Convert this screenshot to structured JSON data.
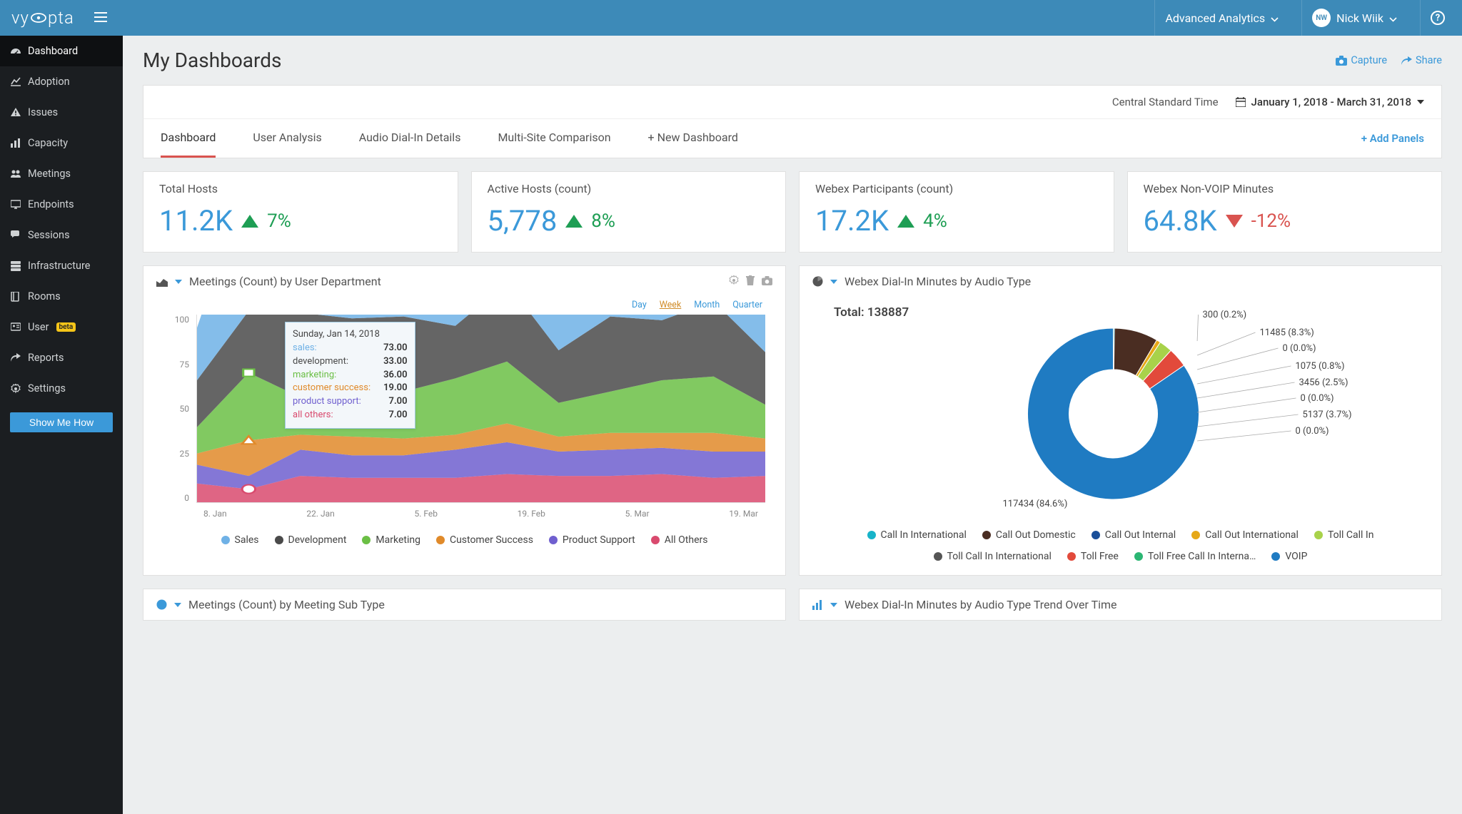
{
  "header": {
    "logo_text": "vy  pta",
    "product_dropdown": "Advanced Analytics",
    "user_initials": "NW",
    "user_name": "Nick Wiik"
  },
  "sidebar": {
    "items": [
      {
        "label": "Dashboard",
        "icon": "gauge",
        "active": true
      },
      {
        "label": "Adoption",
        "icon": "chart-line"
      },
      {
        "label": "Issues",
        "icon": "warning"
      },
      {
        "label": "Capacity",
        "icon": "bar-chart"
      },
      {
        "label": "Meetings",
        "icon": "users"
      },
      {
        "label": "Endpoints",
        "icon": "monitor"
      },
      {
        "label": "Sessions",
        "icon": "comments"
      },
      {
        "label": "Infrastructure",
        "icon": "server"
      },
      {
        "label": "Rooms",
        "icon": "book"
      },
      {
        "label": "User",
        "icon": "id-card",
        "badge": "beta"
      },
      {
        "label": "Reports",
        "icon": "share"
      },
      {
        "label": "Settings",
        "icon": "gear"
      }
    ],
    "cta": "Show Me How"
  },
  "page": {
    "title": "My Dashboards",
    "actions": {
      "capture": "Capture",
      "share": "Share"
    },
    "timezone": "Central Standard Time",
    "date_range": "January 1, 2018 - March 31, 2018",
    "tabs": [
      "Dashboard",
      "User Analysis",
      "Audio Dial-In Details",
      "Multi-Site Comparison",
      "+ New Dashboard"
    ],
    "add_panels": "+ Add Panels"
  },
  "kpis": [
    {
      "label": "Total Hosts",
      "value": "11.2K",
      "dir": "up",
      "pct": "7%"
    },
    {
      "label": "Active Hosts (count)",
      "value": "5,778",
      "dir": "up",
      "pct": "8%"
    },
    {
      "label": "Webex Participants (count)",
      "value": "17.2K",
      "dir": "up",
      "pct": "4%"
    },
    {
      "label": "Webex Non-VOIP Minutes",
      "value": "64.8K",
      "dir": "down",
      "pct": "-12%"
    }
  ],
  "panels": {
    "meetings": {
      "title": "Meetings (Count) by User Department",
      "granularity": [
        "Day",
        "Week",
        "Month",
        "Quarter"
      ],
      "granularity_active": "Week",
      "tooltip": {
        "date": "Sunday, Jan 14, 2018",
        "rows": [
          {
            "label": "sales:",
            "value": "73.00",
            "color": "#6fb1e6"
          },
          {
            "label": "development:",
            "value": "33.00",
            "color": "#4a4a4a"
          },
          {
            "label": "marketing:",
            "value": "36.00",
            "color": "#6bbf45"
          },
          {
            "label": "customer success:",
            "value": "19.00",
            "color": "#e08a2a"
          },
          {
            "label": "product support:",
            "value": "7.00",
            "color": "#6f5fcf"
          },
          {
            "label": "all others:",
            "value": "7.00",
            "color": "#d94a6e"
          }
        ]
      }
    },
    "donut": {
      "title": "Webex Dial-In Minutes by Audio Type",
      "total_label": "Total: 138887",
      "slice_labels": [
        "300 (0.2%)",
        "11485 (8.3%)",
        "0 (0.0%)",
        "1075 (0.8%)",
        "3456 (2.5%)",
        "0 (0.0%)",
        "5137 (3.7%)",
        "0 (0.0%)",
        "117434 (84.6%)"
      ],
      "legend": [
        {
          "label": "Call In International",
          "color": "#17b3c9"
        },
        {
          "label": "Call Out Domestic",
          "color": "#4a2d22"
        },
        {
          "label": "Call Out Internal",
          "color": "#1a4f99"
        },
        {
          "label": "Call Out International",
          "color": "#e6a817"
        },
        {
          "label": "Toll Call In",
          "color": "#a8d24a"
        },
        {
          "label": "Toll Call In International",
          "color": "#555"
        },
        {
          "label": "Toll Free",
          "color": "#e24a3b"
        },
        {
          "label": "Toll Free Call In Interna…",
          "color": "#2bb673"
        },
        {
          "label": "VOIP",
          "color": "#1f7bc2"
        }
      ]
    },
    "bottom": [
      "Meetings (Count) by Meeting Sub Type",
      "Webex Dial-In Minutes by Audio Type Trend Over Time"
    ]
  },
  "chart_data": [
    {
      "type": "area",
      "title": "Meetings (Count) by User Department",
      "ylabel": "",
      "ylim": [
        0,
        100
      ],
      "x_labels": [
        "8. Jan",
        "22. Jan",
        "5. Feb",
        "19. Feb",
        "5. Mar",
        "19. Mar"
      ],
      "y_ticks": [
        0,
        25,
        50,
        75,
        100
      ],
      "series": [
        {
          "name": "Sales",
          "color": "#6fb1e6",
          "values": [
            28,
            73,
            30,
            32,
            30,
            28,
            30,
            32,
            30,
            28,
            28,
            27
          ]
        },
        {
          "name": "Development",
          "color": "#4a4a4a",
          "values": [
            25,
            33,
            45,
            28,
            40,
            28,
            42,
            28,
            40,
            32,
            40,
            28
          ]
        },
        {
          "name": "Marketing",
          "color": "#6bbf45",
          "values": [
            14,
            36,
            20,
            35,
            25,
            30,
            33,
            18,
            22,
            28,
            30,
            18
          ]
        },
        {
          "name": "Customer Success",
          "color": "#e08a2a",
          "values": [
            6,
            19,
            8,
            10,
            9,
            8,
            10,
            8,
            9,
            8,
            10,
            7
          ]
        },
        {
          "name": "Product Support",
          "color": "#6f5fcf",
          "values": [
            10,
            7,
            14,
            12,
            12,
            15,
            17,
            13,
            14,
            14,
            14,
            13
          ]
        },
        {
          "name": "All Others",
          "color": "#d94a6e",
          "values": [
            10,
            7,
            14,
            13,
            13,
            13,
            15,
            14,
            14,
            15,
            13,
            14
          ]
        }
      ],
      "legend_position": "bottom"
    },
    {
      "type": "pie",
      "title": "Webex Dial-In Minutes by Audio Type",
      "total": 138887,
      "series": [
        {
          "name": "Call In International",
          "value": 300,
          "pct": 0.2,
          "color": "#17b3c9"
        },
        {
          "name": "Call Out Domestic",
          "value": 11485,
          "pct": 8.3,
          "color": "#4a2d22"
        },
        {
          "name": "Call Out Internal",
          "value": 0,
          "pct": 0.0,
          "color": "#1a4f99"
        },
        {
          "name": "Call Out International",
          "value": 1075,
          "pct": 0.8,
          "color": "#e6a817"
        },
        {
          "name": "Toll Call In",
          "value": 3456,
          "pct": 2.5,
          "color": "#a8d24a"
        },
        {
          "name": "Toll Call In International",
          "value": 0,
          "pct": 0.0,
          "color": "#555"
        },
        {
          "name": "Toll Free",
          "value": 5137,
          "pct": 3.7,
          "color": "#e24a3b"
        },
        {
          "name": "Toll Free Call In International",
          "value": 0,
          "pct": 0.0,
          "color": "#2bb673"
        },
        {
          "name": "VOIP",
          "value": 117434,
          "pct": 84.6,
          "color": "#1f7bc2"
        }
      ]
    }
  ]
}
